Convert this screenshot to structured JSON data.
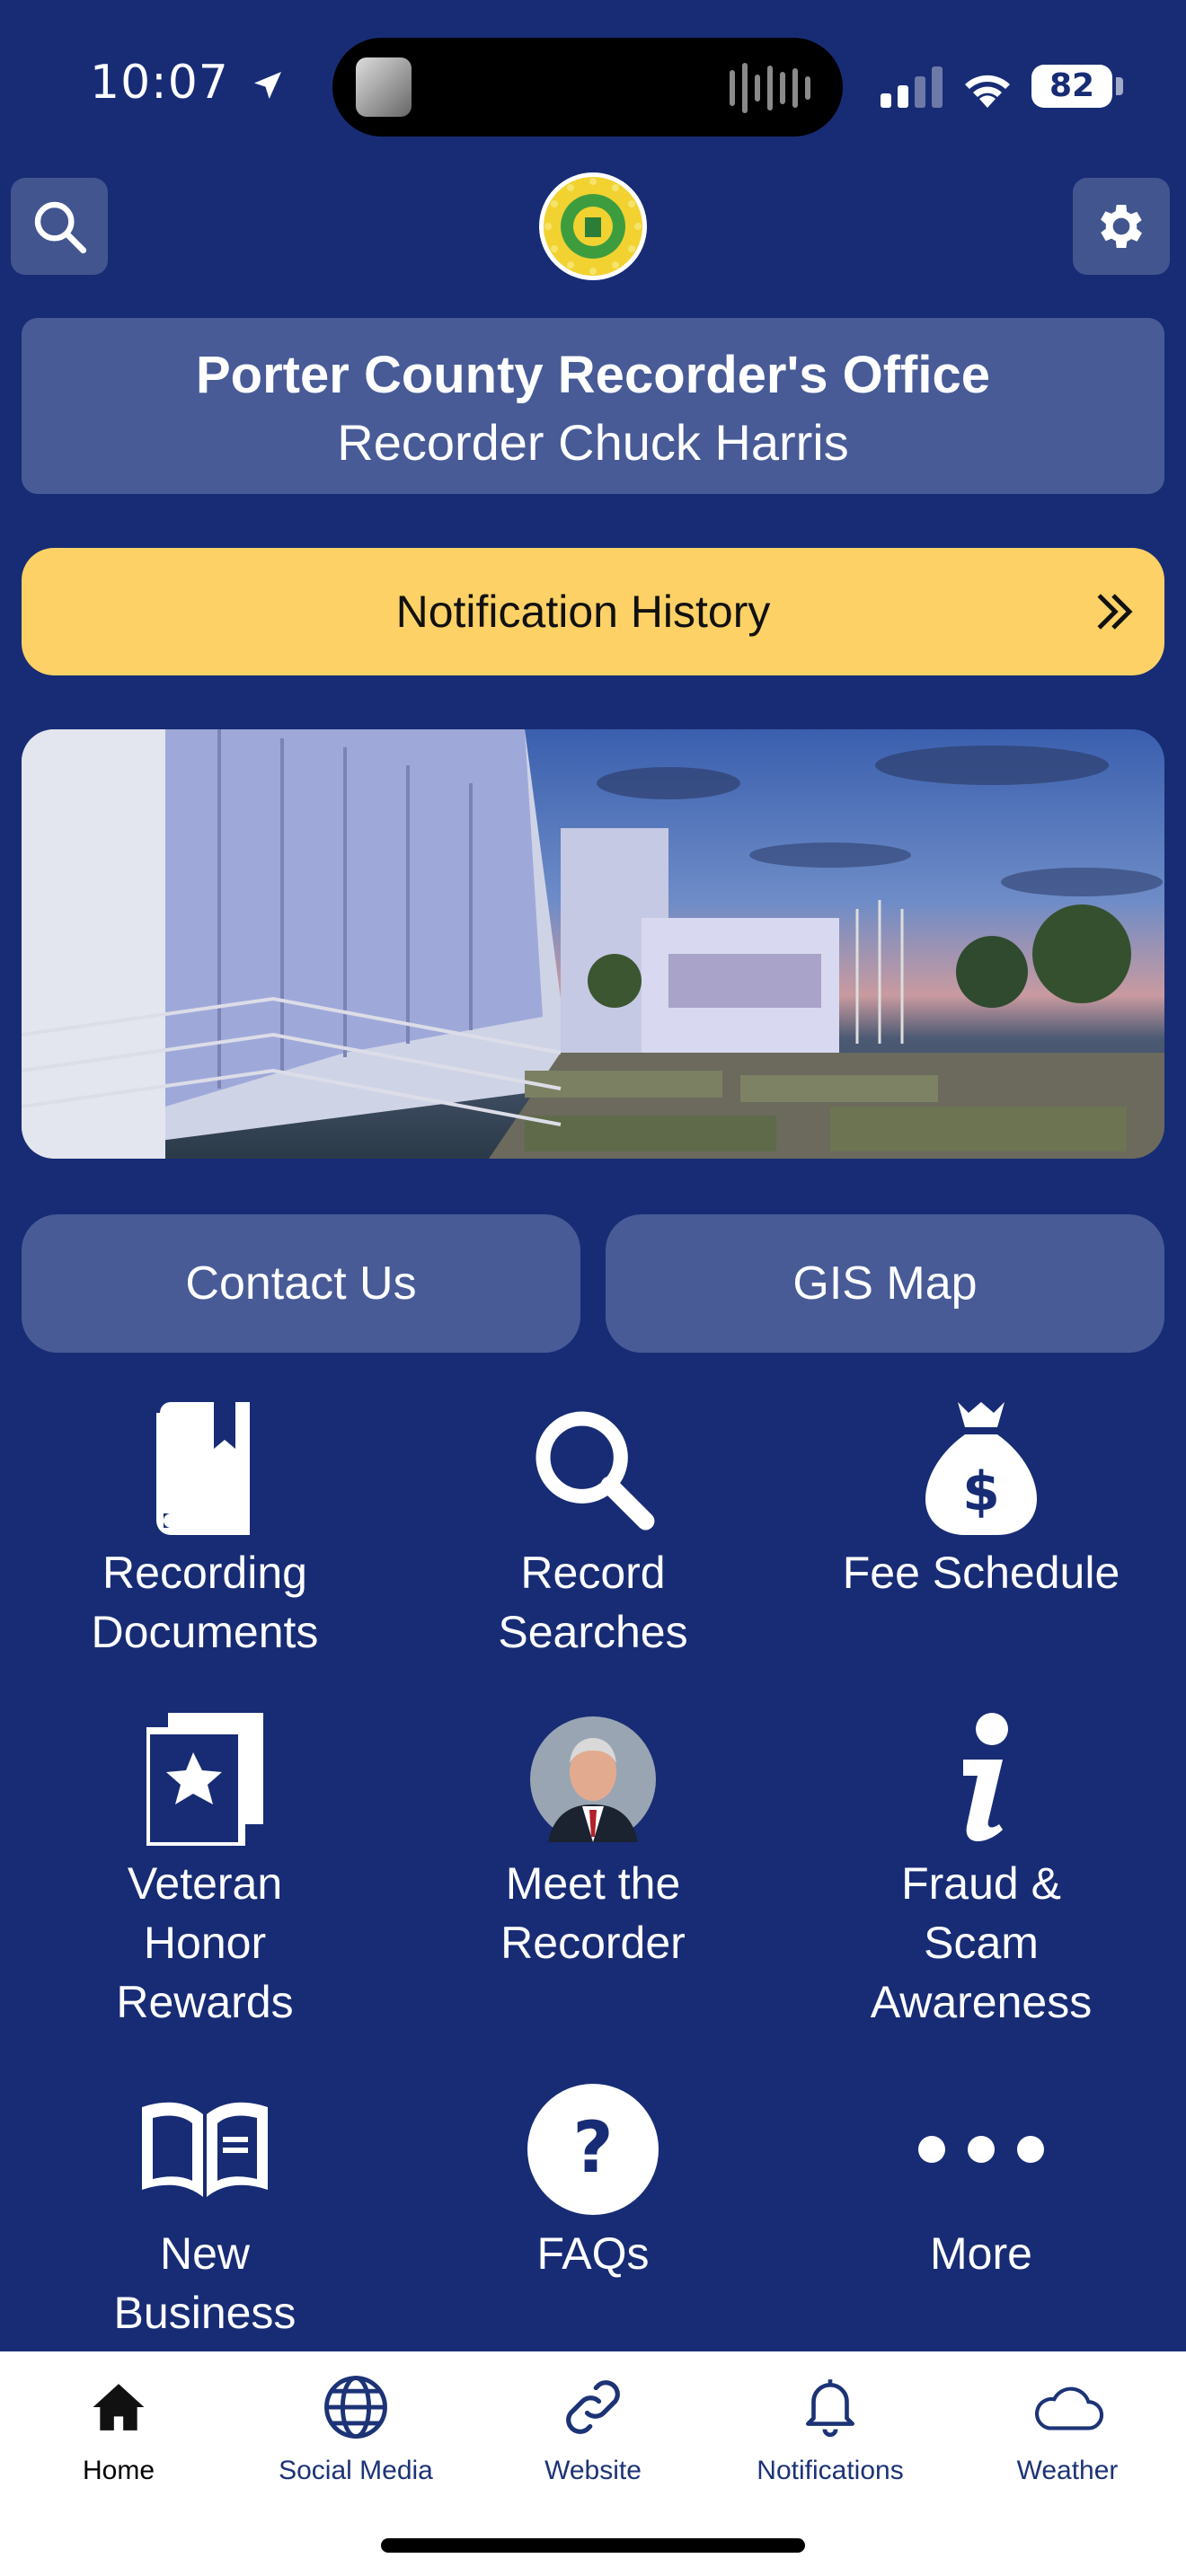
{
  "status_bar": {
    "time": "10:07",
    "battery": "82"
  },
  "header": {
    "logo_text": "PORTER 1836 COUNTY"
  },
  "office": {
    "title": "Porter County Recorder's Office",
    "subtitle": "Recorder Chuck Harris"
  },
  "notification_history": {
    "label": "Notification History"
  },
  "quick_links": {
    "contact_label": "Contact Us",
    "gis_label": "GIS Map"
  },
  "grid": {
    "items": [
      {
        "label": "Recording\nDocuments",
        "icon": "book-icon"
      },
      {
        "label": "Record\nSearches",
        "icon": "magnifier-icon"
      },
      {
        "label": "Fee Schedule",
        "icon": "money-bag-icon"
      },
      {
        "label": "Veteran\nHonor\nRewards",
        "icon": "veteran-star-icon"
      },
      {
        "label": "Meet the\nRecorder",
        "icon": "recorder-portrait"
      },
      {
        "label": "Fraud &\nScam\nAwareness",
        "icon": "info-icon"
      },
      {
        "label": "New\nBusiness",
        "icon": "open-book-icon"
      },
      {
        "label": "FAQs",
        "icon": "question-icon"
      },
      {
        "label": "More",
        "icon": "more-dots-icon"
      }
    ]
  },
  "tabbar": {
    "tabs": [
      {
        "label": "Home",
        "icon": "home-icon",
        "active": true
      },
      {
        "label": "Social Media",
        "icon": "globe-icon",
        "active": false
      },
      {
        "label": "Website",
        "icon": "link-icon",
        "active": false
      },
      {
        "label": "Notifications",
        "icon": "bell-icon",
        "active": false
      },
      {
        "label": "Weather",
        "icon": "cloud-icon",
        "active": false
      }
    ]
  },
  "colors": {
    "background": "#182c75",
    "card": "#485b97",
    "accent_yellow": "#fdd165",
    "tab_text": "#1c3376"
  }
}
